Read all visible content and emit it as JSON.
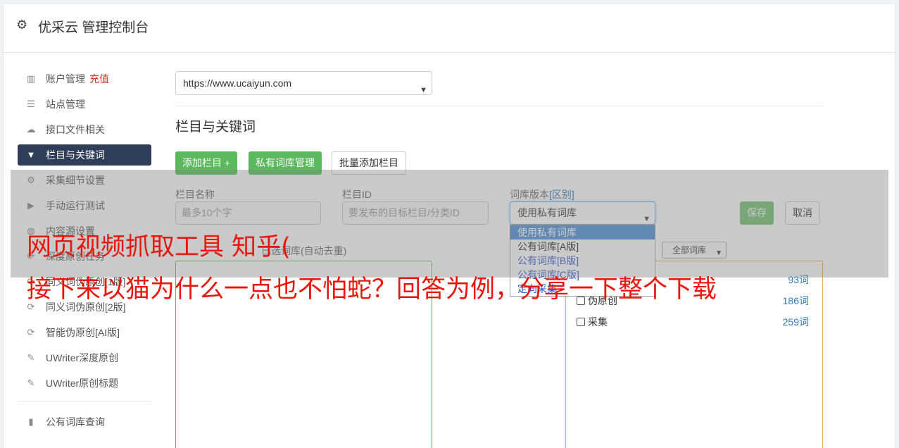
{
  "header": {
    "icon": "gear-icon",
    "title": "优采云 管理控制台"
  },
  "sidebar": {
    "items": [
      {
        "label": "账户管理",
        "badge": "充值",
        "icon": "bar-chart-icon"
      },
      {
        "label": "站点管理",
        "icon": "server-icon"
      },
      {
        "label": "接口文件相关",
        "icon": "cloud-upload-icon"
      },
      {
        "label": "栏目与关键词",
        "icon": "filter-icon",
        "active": true
      },
      {
        "label": "采集细节设置",
        "icon": "gears-icon"
      },
      {
        "label": "手动运行测试",
        "icon": "play-circle-icon"
      },
      {
        "label": "内容源设置",
        "icon": "database-icon"
      },
      {
        "label": "深度原创任务",
        "icon": "refresh-icon"
      },
      {
        "label": "同义词伪原创[1版]",
        "icon": "refresh-icon"
      },
      {
        "label": "同义词伪原创[2版]",
        "icon": "refresh-icon"
      },
      {
        "label": "智能伪原创[AI版]",
        "icon": "refresh-icon"
      },
      {
        "label": "UWriter深度原创",
        "icon": "edit-icon"
      },
      {
        "label": "UWriter原创标题",
        "icon": "edit-icon"
      },
      {
        "label": "公有词库查询",
        "icon": "book-icon"
      }
    ]
  },
  "main": {
    "site_select": {
      "value": "https://www.ucaiyun.com"
    },
    "section_title": "栏目与关键词",
    "buttons": {
      "add_column": "添加栏目 +",
      "private_lib": "私有词库管理",
      "batch_add": "批量添加栏目"
    },
    "form": {
      "column_name_label": "栏目名称",
      "column_name_placeholder": "最多10个字",
      "column_id_label": "栏目ID",
      "column_id_placeholder": "要发布的目标栏目/分类ID",
      "lib_version_label": "词库版本",
      "lib_version_hint": "[区别]",
      "lib_version_value": "使用私有词库",
      "save": "保存",
      "cancel": "取消"
    },
    "dropdown_options": [
      "使用私有词库",
      "公有词库[A版]",
      "公有词库[B版]",
      "公有词库[C版]",
      "定向采集"
    ],
    "selected_label": "已选词库(自动去重)",
    "lib_filter": "全部词库",
    "lib_rows": [
      {
        "label": "",
        "count": "93词"
      },
      {
        "label": "伪原创",
        "count": "186词"
      },
      {
        "label": "采集",
        "count": "259词"
      }
    ]
  },
  "watermark": {
    "line1": "网页视频抓取工具 知乎(",
    "line2": "接下来以猫为什么一点也不怕蛇？回答为例，分享一下整个下载",
    "color": "#e8160c"
  }
}
